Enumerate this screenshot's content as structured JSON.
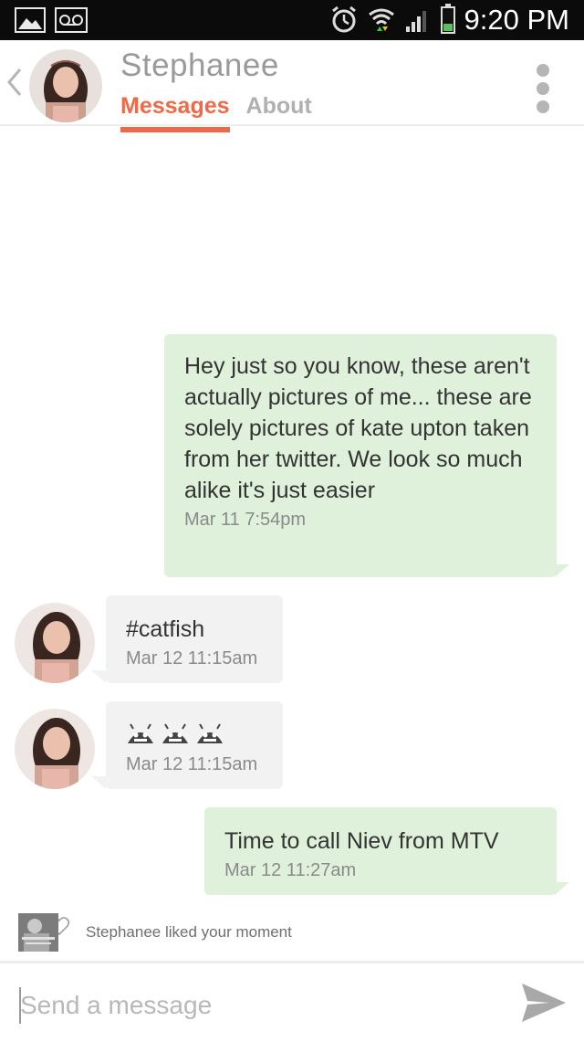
{
  "status_bar": {
    "time": "9:20 PM"
  },
  "header": {
    "back_icon": "chevron-left-icon",
    "name": "Stephanee",
    "tabs": [
      {
        "label": "Messages",
        "active": true
      },
      {
        "label": "About",
        "active": false
      }
    ],
    "menu_icon": "more-vertical-icon"
  },
  "messages": [
    {
      "direction": "outgoing",
      "text": "Hey just so you know, these aren't actually pictures of me... these are solely pictures of kate upton taken from her twitter. We look so much alike it's just easier",
      "time": "Mar 11 7:54pm"
    },
    {
      "direction": "incoming",
      "text": "#catfish",
      "time": "Mar 12 11:15am"
    },
    {
      "direction": "incoming",
      "text": "",
      "emoji_icons": [
        "android-face-icon",
        "android-face-icon",
        "android-face-icon"
      ],
      "time": "Mar 12 11:15am"
    },
    {
      "direction": "outgoing",
      "text": "Time to call Niev from MTV",
      "time": "Mar 12 11:27am"
    }
  ],
  "notification": {
    "text": "Stephanee liked your moment",
    "icon": "heart-icon"
  },
  "composer": {
    "placeholder": "Send a message",
    "value": "",
    "send_icon": "send-icon"
  },
  "colors": {
    "accent": "#ef6948",
    "outgoing_bubble": "#dff1db",
    "incoming_bubble": "#f2f2f2"
  }
}
